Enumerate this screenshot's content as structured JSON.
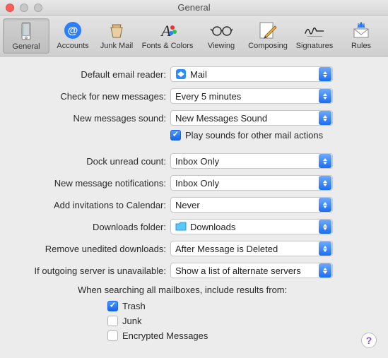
{
  "window": {
    "title": "General"
  },
  "toolbar": {
    "items": [
      {
        "id": "general",
        "label": "General"
      },
      {
        "id": "accounts",
        "label": "Accounts"
      },
      {
        "id": "junkmail",
        "label": "Junk Mail"
      },
      {
        "id": "fontscolors",
        "label": "Fonts & Colors"
      },
      {
        "id": "viewing",
        "label": "Viewing"
      },
      {
        "id": "composing",
        "label": "Composing"
      },
      {
        "id": "signatures",
        "label": "Signatures"
      },
      {
        "id": "rules",
        "label": "Rules"
      }
    ],
    "selected": "general"
  },
  "form": {
    "default_reader": {
      "label": "Default email reader:",
      "value": "Mail"
    },
    "check_messages": {
      "label": "Check for new messages:",
      "value": "Every 5 minutes"
    },
    "new_msg_sound": {
      "label": "New messages sound:",
      "value": "New Messages Sound"
    },
    "play_sounds": {
      "label": "Play sounds for other mail actions",
      "checked": true
    },
    "dock_unread": {
      "label": "Dock unread count:",
      "value": "Inbox Only"
    },
    "new_msg_notif": {
      "label": "New message notifications:",
      "value": "Inbox Only"
    },
    "add_invites": {
      "label": "Add invitations to Calendar:",
      "value": "Never"
    },
    "downloads_folder": {
      "label": "Downloads folder:",
      "value": "Downloads"
    },
    "remove_downloads": {
      "label": "Remove unedited downloads:",
      "value": "After Message is Deleted"
    },
    "outgoing_unavailable": {
      "label": "If outgoing server is unavailable:",
      "value": "Show a list of alternate servers"
    },
    "search_heading": "When searching all mailboxes, include results from:",
    "search_trash": {
      "label": "Trash",
      "checked": true
    },
    "search_junk": {
      "label": "Junk",
      "checked": false
    },
    "search_encrypted": {
      "label": "Encrypted Messages",
      "checked": false
    }
  },
  "help": {
    "symbol": "?"
  }
}
